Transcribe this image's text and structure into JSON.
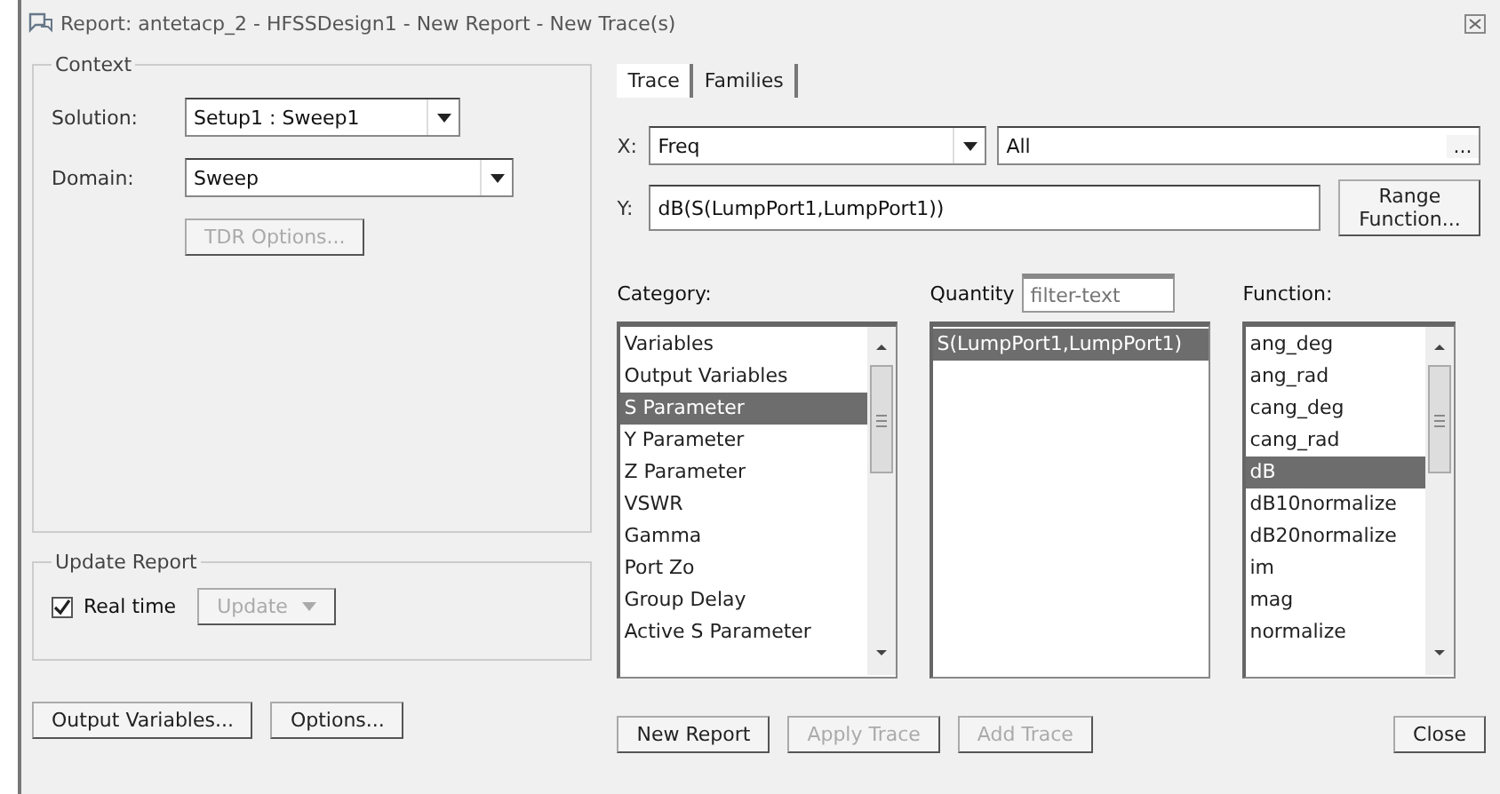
{
  "window": {
    "title": "Report: antetacp_2 - HFSSDesign1 - New Report - New Trace(s)"
  },
  "context": {
    "title": "Context",
    "solution": {
      "label": "Solution:",
      "value": "Setup1 : Sweep1"
    },
    "domain": {
      "label": "Domain:",
      "value": "Sweep"
    },
    "tdr_button": {
      "label": "TDR Options...",
      "disabled": true
    }
  },
  "update_report": {
    "title": "Update Report",
    "real_time": {
      "label": "Real time",
      "checked": true
    },
    "update_button": {
      "label": "Update",
      "disabled": true
    }
  },
  "tabs": [
    {
      "label": "Trace",
      "selected": true
    },
    {
      "label": "Families",
      "selected": false
    }
  ],
  "x": {
    "label": "X:",
    "value": "Freq",
    "range": "All",
    "range_button": "..."
  },
  "y": {
    "label": "Y:",
    "value": "dB(S(LumpPort1,LumpPort1))",
    "button": "Range Function..."
  },
  "category": {
    "label": "Category:",
    "items": [
      {
        "label": "Variables",
        "selected": false
      },
      {
        "label": "Output Variables",
        "selected": false
      },
      {
        "label": "S Parameter",
        "selected": true
      },
      {
        "label": "Y Parameter",
        "selected": false
      },
      {
        "label": "Z Parameter",
        "selected": false
      },
      {
        "label": "VSWR",
        "selected": false
      },
      {
        "label": "Gamma",
        "selected": false
      },
      {
        "label": "Port Zo",
        "selected": false
      },
      {
        "label": "Group Delay",
        "selected": false
      },
      {
        "label": "Active S Parameter",
        "selected": false
      }
    ]
  },
  "quantity": {
    "label": "Quantity",
    "placeholder": "filter-text",
    "items": [
      {
        "label": "S(LumpPort1,LumpPort1)",
        "selected": true
      }
    ]
  },
  "function": {
    "label": "Function:",
    "items": [
      {
        "label": "ang_deg",
        "selected": false
      },
      {
        "label": "ang_rad",
        "selected": false
      },
      {
        "label": "cang_deg",
        "selected": false
      },
      {
        "label": "cang_rad",
        "selected": false
      },
      {
        "label": "dB",
        "selected": true
      },
      {
        "label": "dB10normalize",
        "selected": false
      },
      {
        "label": "dB20normalize",
        "selected": false
      },
      {
        "label": "im",
        "selected": false
      },
      {
        "label": "mag",
        "selected": false
      },
      {
        "label": "normalize",
        "selected": false
      }
    ]
  },
  "buttons_left": [
    {
      "label": "Output Variables...",
      "disabled": false
    },
    {
      "label": "Options...",
      "disabled": false
    }
  ],
  "buttons_right": [
    {
      "label": "New Report",
      "disabled": false
    },
    {
      "label": "Apply Trace",
      "disabled": true
    },
    {
      "label": "Add Trace",
      "disabled": true
    }
  ],
  "close_button": {
    "label": "Close",
    "disabled": false
  }
}
